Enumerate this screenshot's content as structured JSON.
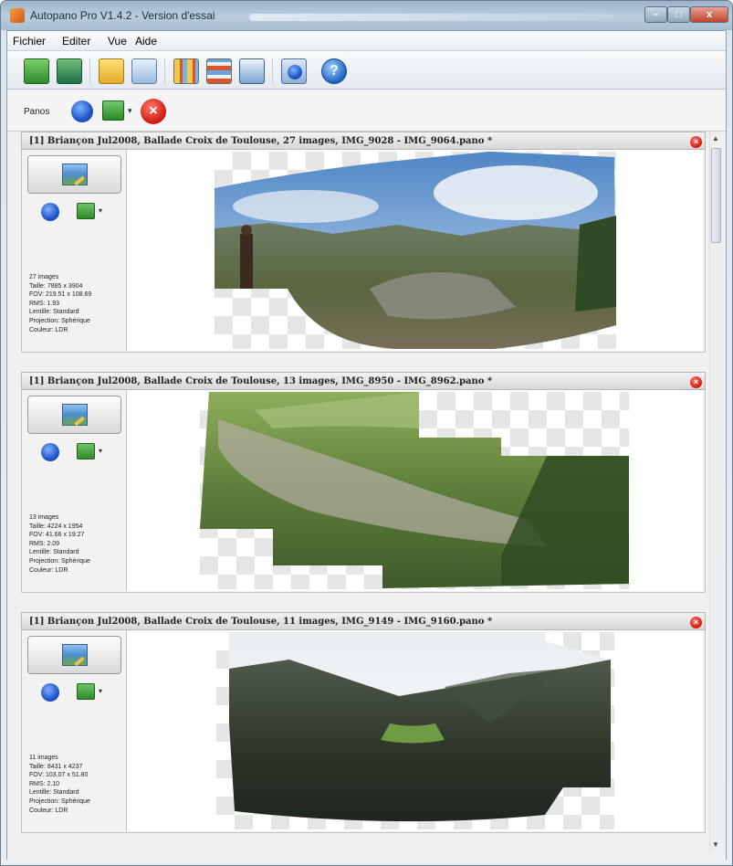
{
  "window": {
    "title": "Autopano Pro V1.4.2 - Version d'essai",
    "min_label": "–",
    "max_label": "□",
    "close_label": "x"
  },
  "menu": [
    "Fichier",
    "Editer",
    "Vue",
    "Aide"
  ],
  "toolbar": {
    "icons": [
      "open-pano-icon",
      "save-pano-icon",
      "open-folder-icon",
      "detect-icon",
      "grid-view-1-icon",
      "grid-view-2-icon",
      "grid-view-3-icon",
      "settings-icon",
      "help-icon"
    ]
  },
  "panos_bar": {
    "label": "Panos"
  },
  "panos": [
    {
      "title": "[1] Briançon Jul2008, Ballade Croix de Toulouse, 27 images, IMG_9028 - IMG_9064.pano *",
      "info": [
        "27 images",
        "Taille: 7885 x 3904",
        "FOV: 219.51 x 108.69",
        "RMS: 1.93",
        "Lentille: Standard",
        "Projection: Sphérique",
        "Couleur: LDR"
      ]
    },
    {
      "title": "[1] Briançon Jul2008, Ballade Croix de Toulouse, 13 images, IMG_8950 - IMG_8962.pano *",
      "info": [
        "13 images",
        "Taille: 4224 x 1954",
        "FOV: 41.66 x 19.27",
        "RMS: 2.09",
        "Lentille: Standard",
        "Projection: Sphérique",
        "Couleur: LDR"
      ]
    },
    {
      "title": "[1] Briançon Jul2008, Ballade Croix de Toulouse, 11 images, IMG_9149 - IMG_9160.pano *",
      "info": [
        "11 images",
        "Taille: 8431 x 4237",
        "FOV: 103.07 x 51.80",
        "RMS: 2.10",
        "Lentille: Standard",
        "Projection: Sphérique",
        "Couleur: LDR"
      ]
    }
  ]
}
